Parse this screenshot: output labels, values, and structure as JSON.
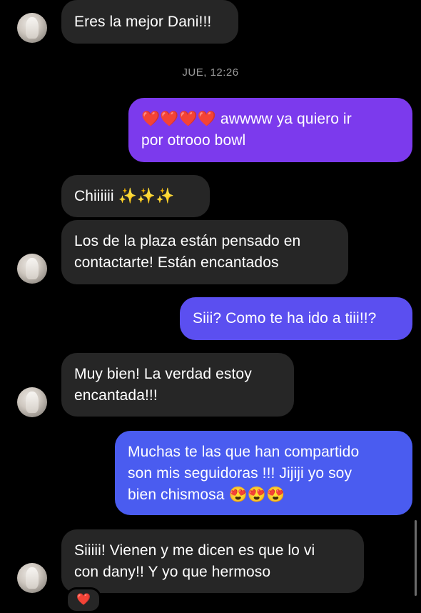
{
  "messages": [
    {
      "text": "Eres la mejor Dani!!!"
    },
    {
      "text": "❤️❤️❤️❤️ awwww ya quiero ir\npor otrooo bowl"
    },
    {
      "text": "Chiiiiii ✨✨✨"
    },
    {
      "text": "Los de la plaza están pensado en\ncontactarte! Están encantados"
    },
    {
      "text": "Siii? Como te ha ido a tiii!!?"
    },
    {
      "text": "Muy bien! La verdad estoy\nencantada!!!"
    },
    {
      "text": "Muchas te las que han compartido\nson mis seguidoras !!! Jijiji yo soy\nbien chismosa 😍😍😍"
    },
    {
      "text": "Siiiii! Vienen y me dicen es que lo vi\ncon dany!! Y yo que hermoso"
    }
  ],
  "timestamp": "JUE, 12:26",
  "reaction": "❤️",
  "colors": {
    "background": "#000000",
    "incoming_bubble": "#262626",
    "outgoing_purple": "#7c3aed",
    "outgoing_blue": "#5b4ff0"
  }
}
